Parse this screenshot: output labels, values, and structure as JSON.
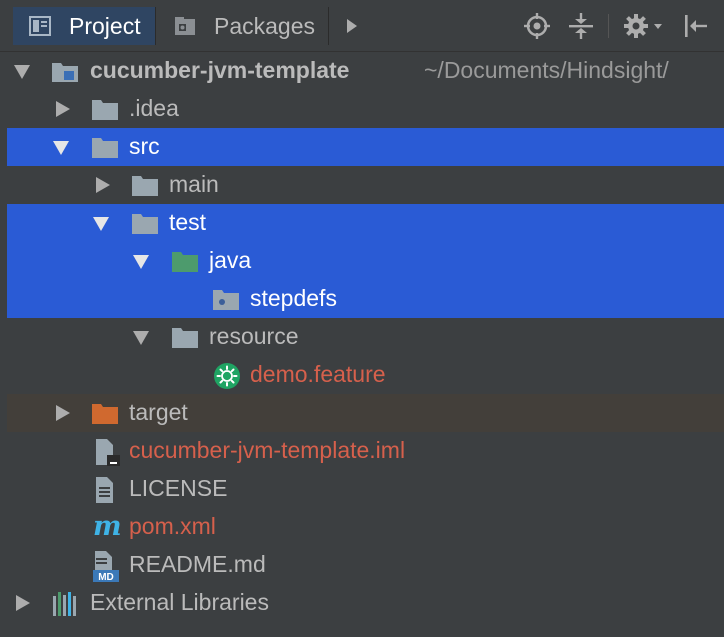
{
  "tabs": [
    {
      "label": "Project",
      "active": true
    },
    {
      "label": "Packages",
      "active": false
    }
  ],
  "toolbar_icons": [
    "play-arrow-icon",
    "locate-target-icon",
    "collapse-all-icon",
    "gear-icon",
    "hide-panel-icon"
  ],
  "tree": {
    "root": {
      "name": "cucumber-jvm-template",
      "path": "~/Documents/Hindsight/"
    },
    "items": [
      {
        "label": ".idea"
      },
      {
        "label": "src"
      },
      {
        "label": "main"
      },
      {
        "label": "test"
      },
      {
        "label": "java"
      },
      {
        "label": "stepdefs"
      },
      {
        "label": "resource"
      },
      {
        "label": "demo.feature"
      },
      {
        "label": "target"
      },
      {
        "label": "cucumber-jvm-template.iml"
      },
      {
        "label": "LICENSE"
      },
      {
        "label": "pom.xml"
      },
      {
        "label": "README.md"
      },
      {
        "label": "External Libraries"
      }
    ],
    "maven_letter": "m",
    "md_badge": "MD"
  },
  "colors": {
    "background": "#3c3f41",
    "selection": "#2a5bd5",
    "active_tab": "#2f4562",
    "excluded_row": "#433f3a",
    "folder": "#9aa7b0",
    "source_root": "#4d9b6d",
    "excluded_folder": "#d0692f",
    "modified_text": "#d6604c",
    "cucumber": "#1fa463",
    "maven": "#3fb3e6"
  }
}
